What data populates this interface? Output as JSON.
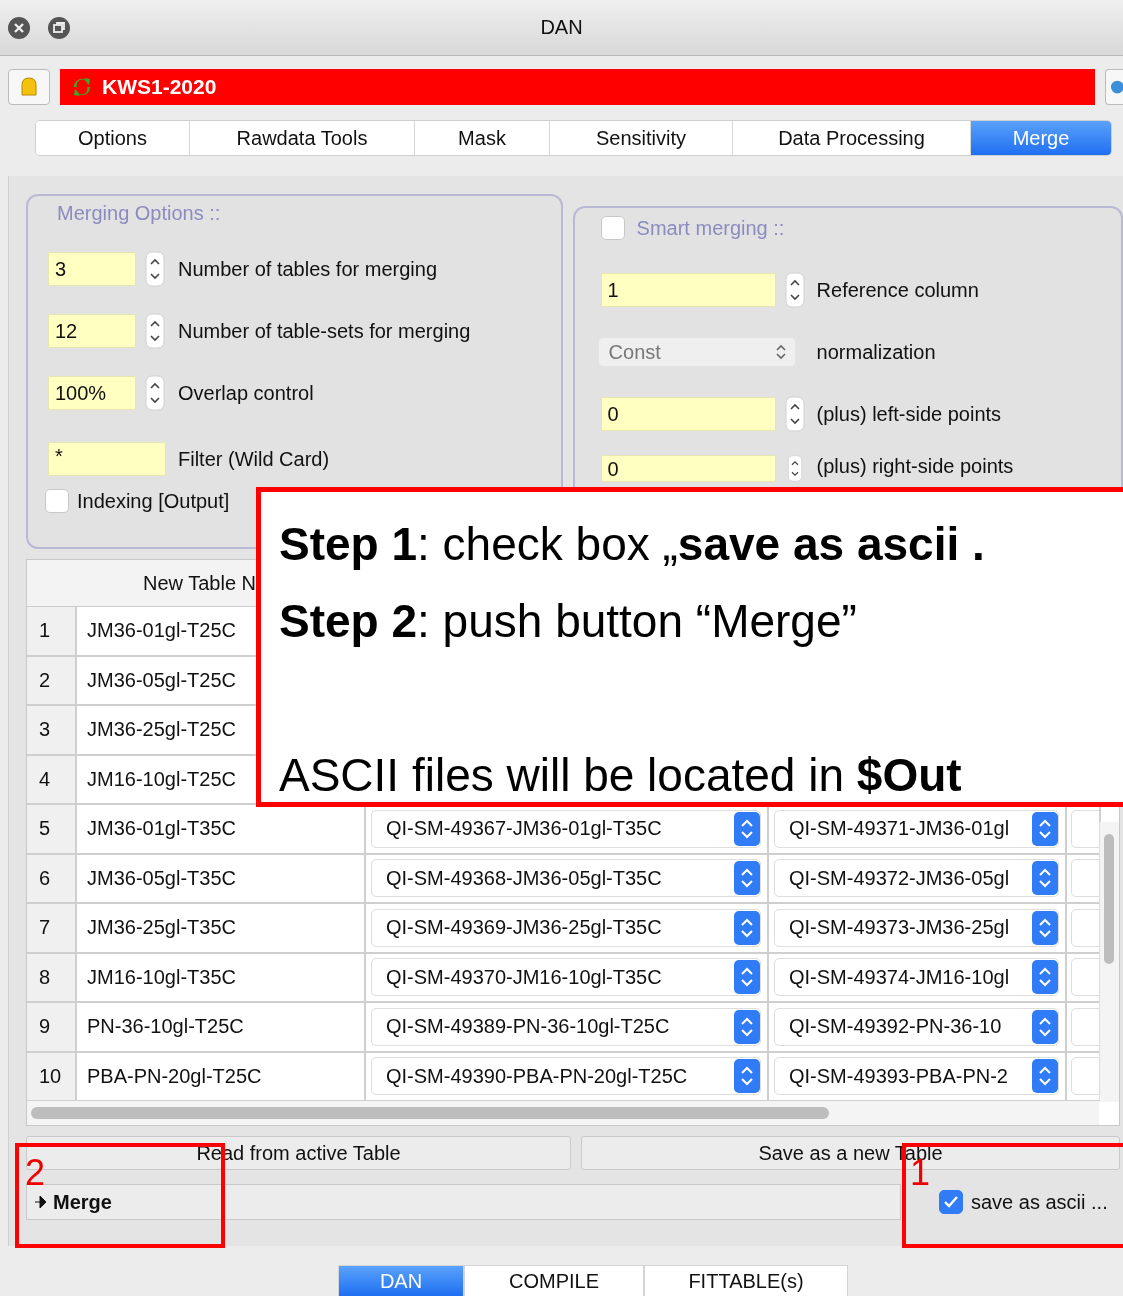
{
  "window": {
    "title": "DAN"
  },
  "header": {
    "title": "KWS1-2020"
  },
  "tabs": [
    {
      "label": "Options",
      "selected": false
    },
    {
      "label": "Rawdata Tools",
      "selected": false
    },
    {
      "label": "Mask",
      "selected": false
    },
    {
      "label": "Sensitivity",
      "selected": false
    },
    {
      "label": "Data Processing",
      "selected": false
    },
    {
      "label": "Merge",
      "selected": true
    }
  ],
  "merging_options": {
    "title": "Merging Options ::",
    "fields": [
      {
        "kind": "spin",
        "value": "3",
        "label": "Number of tables for merging"
      },
      {
        "kind": "spin",
        "value": "12",
        "label": "Number of table-sets for merging"
      },
      {
        "kind": "spin",
        "value": "100%",
        "label": "Overlap control"
      },
      {
        "kind": "text",
        "value": "*",
        "label": "Filter (Wild Card)"
      }
    ],
    "indexing": {
      "label": "Indexing [Output]",
      "checked": false
    }
  },
  "smart_merging": {
    "title": "Smart merging ::",
    "checked": false,
    "fields": [
      {
        "kind": "spin",
        "value": "1",
        "label": "Reference column"
      },
      {
        "kind": "select",
        "value": "Const",
        "label": "normalization"
      },
      {
        "kind": "spin",
        "value": "0",
        "label": "(plus) left-side points"
      },
      {
        "kind": "spin",
        "value": "0",
        "label": "(plus) right-side points"
      }
    ]
  },
  "table": {
    "columns": [
      "New Table N"
    ],
    "rows": [
      {
        "number": "1",
        "name": "JM36-01gl-T25C"
      },
      {
        "number": "2",
        "name": "JM36-05gl-T25C"
      },
      {
        "number": "3",
        "name": "JM36-25gl-T25C"
      },
      {
        "number": "4",
        "name": "JM16-10gl-T25C"
      },
      {
        "number": "5",
        "name": "JM36-01gl-T35C",
        "column_2": "QI-SM-49367-JM36-01gl-T35C",
        "column_3": "QI-SM-49371-JM36-01gl"
      },
      {
        "number": "6",
        "name": "JM36-05gl-T35C",
        "column_2": "QI-SM-49368-JM36-05gl-T35C",
        "column_3": "QI-SM-49372-JM36-05gl"
      },
      {
        "number": "7",
        "name": "JM36-25gl-T35C",
        "column_2": "QI-SM-49369-JM36-25gl-T35C",
        "column_3": "QI-SM-49373-JM36-25gl"
      },
      {
        "number": "8",
        "name": "JM16-10gl-T35C",
        "column_2": "QI-SM-49370-JM16-10gl-T35C",
        "column_3": "QI-SM-49374-JM16-10gl"
      },
      {
        "number": "9",
        "name": "PN-36-10gl-T25C",
        "column_2": "QI-SM-49389-PN-36-10gl-T25C",
        "column_3": "QI-SM-49392-PN-36-10"
      },
      {
        "number": "10",
        "name": "PBA-PN-20gl-T25C",
        "column_2": "QI-SM-49390-PBA-PN-20gl-T25C",
        "column_3": "QI-SM-49393-PBA-PN-2"
      }
    ]
  },
  "buttons": [
    "Read from active Table",
    "Save as a new Table"
  ],
  "merge_button": "Merge",
  "save_ascii": {
    "label": "save as ascii ...",
    "checked": true
  },
  "bottom_tabs": [
    {
      "label": "DAN",
      "selected": true
    },
    {
      "label": "COMPILE",
      "selected": false
    },
    {
      "label": "FITTABLE(s)",
      "selected": false
    }
  ],
  "annotations": {
    "callout": [
      "**Step 1**: check box „**save as ascii .**",
      "**Step 2**: push button “Merge”",
      "ASCII files will be located in **$Out**"
    ],
    "markers": [
      "2",
      "1"
    ]
  }
}
